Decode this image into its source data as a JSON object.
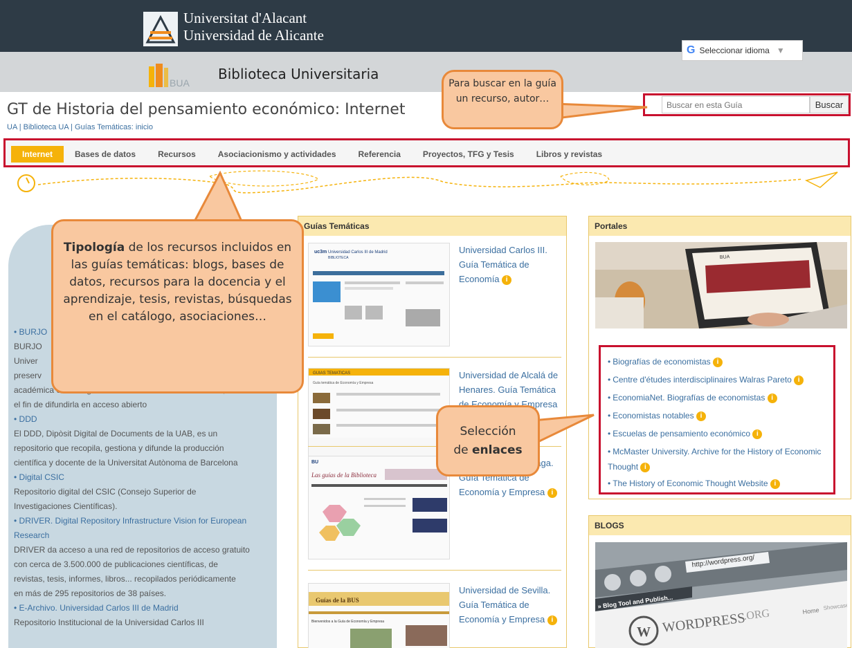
{
  "header": {
    "uni_line1": "Universitat d'Alacant",
    "uni_line2": "Universidad de Alicante",
    "library": "Biblioteca Universitaria",
    "bua_text": "BUA",
    "lang_label": "Seleccionar idioma",
    "lang_g": "G",
    "lang_arrow": "▼"
  },
  "page": {
    "title": "GT de Historia del pensamiento económico: Internet",
    "breadcrumb": "UA | Biblioteca UA | Guías Temáticas: inicio"
  },
  "search": {
    "placeholder": "Buscar en esta Guía",
    "button": "Buscar"
  },
  "nav": {
    "items": [
      "Internet",
      "Bases de datos",
      "Recursos",
      "Asociacionismo y actividades",
      "Referencia",
      "Proyectos, TFG y Tesis",
      "Libros y revistas"
    ]
  },
  "callouts": {
    "search": "Para buscar en la guía un recurso,  autor…",
    "typology_bold": "Tipología",
    "typology_rest": " de los recursos incluidos en las guías temáticas: blogs, bases de datos, recursos para la docencia y el aprendizaje, tesis, revistas, búsquedas en el catálogo, asociaciones…",
    "links_line1": "Selección",
    "links_pre": "de ",
    "links_bold": "enlaces"
  },
  "left_list": [
    {
      "title": "BURJO",
      "desc_lines": [
        "BURJO",
        "Univer",
        "preserv",
        "académica e investigadora de la comunidad universitaria, con",
        "el fin de difundirla en acceso abierto"
      ]
    },
    {
      "title": "DDD",
      "desc_lines": [
        "El DDD, Dipòsit Digital de Documents de la UAB, es un",
        "repositorio que recopila, gestiona y difunde la producción",
        "científica y docente de la Universitat Autònoma de Barcelona"
      ]
    },
    {
      "title": "Digital CSIC",
      "desc_lines": [
        "Repositorio digital del CSIC (Consejo Superior de",
        "Investigaciones Científicas)."
      ]
    },
    {
      "title": "DRIVER. Digital Repository Infrastructure Vision for European",
      "title2": "Research",
      "desc_lines": [
        "DRIVER da acceso a una red de repositorios de acceso gratuito",
        "con cerca de 3.500.000 de publicaciones científicas, de",
        "revistas, tesis, informes, libros... recopilados periódicamente",
        "en más de 295 repositorios de 38 países."
      ]
    },
    {
      "title": "E-Archivo. Universidad Carlos III de Madrid",
      "desc_lines": [
        "Repositorio Institucional de la Universidad Carlos III"
      ]
    }
  ],
  "guias": {
    "heading": "Guías Temáticas",
    "items": [
      {
        "lines": [
          "Universidad Carlos III.",
          "Guía Temática de",
          "Economía"
        ],
        "thumb_header": "Universidad Carlos III de Madrid",
        "thumb_sub": "BIBLIOTECA",
        "thumb_logo": "uc3m"
      },
      {
        "lines": [
          "Universidad de Alcalá de",
          "Henares. Guía Temática",
          "de Economía y Empresa"
        ],
        "thumb_header": "GUIAS TEMATICAS",
        "thumb_sub": "Guía temática de Economía y Empresa"
      },
      {
        "lines": [
          "Universidad de Málaga.",
          "Guía Temática de",
          "Economía y Empresa"
        ],
        "thumb_header": "Las guías de la Biblioteca",
        "thumb_logo": "BU"
      },
      {
        "lines": [
          "Universidad de Sevilla.",
          "Guía Temática de",
          "Economía y Empresa"
        ],
        "thumb_header": "Guías de la BUS",
        "thumb_sub": "Bienvenidos a la Guía de Economía y Empresa"
      }
    ],
    "info": "i"
  },
  "portales": {
    "heading": "Portales",
    "img_text": "BUA",
    "links": [
      "Biografías de economistas",
      "Centre d'études interdisciplinaires Walras Pareto",
      "EconomiaNet. Biografías de economistas",
      "Economistas notables",
      "Escuelas de pensamiento económico",
      "McMaster University. Archive for the History of Economic",
      "The History of Economic Thought Website"
    ],
    "mcmaster_cont": "Thought"
  },
  "blogs": {
    "heading": "BLOGS",
    "url": "http://wordpress.org/",
    "tab": "» Blog Tool and Publish...",
    "brand": "WORDPRESS",
    "brand_suffix": ".ORG",
    "home": "Home",
    "showcase": "Showcase"
  },
  "colors": {
    "accent": "#f5b20a",
    "highlight": "#c8102e",
    "callout_fill": "#f9c8a0",
    "callout_border": "#e8893a",
    "dark": "#2e3b46"
  }
}
